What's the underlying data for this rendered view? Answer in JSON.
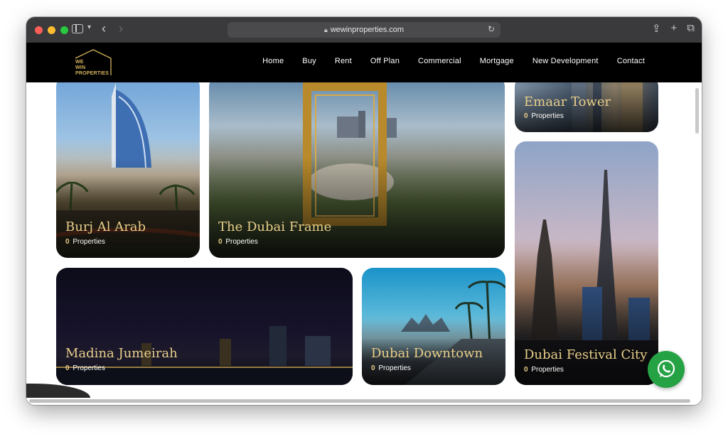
{
  "browser": {
    "url": "wewinproperties.com"
  },
  "site": {
    "logo_text": [
      "WE",
      "WIN",
      "PROPERTIES"
    ],
    "nav": [
      "Home",
      "Buy",
      "Rent",
      "Off Plan",
      "Commercial",
      "Mortgage",
      "New Development",
      "Contact"
    ]
  },
  "cards": {
    "burj": {
      "title": "Burj Al Arab",
      "count": "0",
      "label": "Properties"
    },
    "frame": {
      "title": "The Dubai Frame",
      "count": "0",
      "label": "Properties"
    },
    "emaar": {
      "title": "Emaar Tower",
      "count": "0",
      "label": "Properties"
    },
    "festival": {
      "title": "Dubai Festival City",
      "count": "0",
      "label": "Properties"
    },
    "madina": {
      "title": "Madina Jumeirah",
      "count": "0",
      "label": "Properties"
    },
    "downtown": {
      "title": "Dubai Downtown",
      "count": "0",
      "label": "Properties"
    }
  },
  "colors": {
    "accent_gold": "#e9cf8a",
    "header_bg": "#000000",
    "whatsapp_green": "#25a244"
  },
  "icons": [
    "sidebar-icon",
    "back-icon",
    "forward-icon",
    "lock-icon",
    "reload-icon",
    "share-icon",
    "new-tab-icon",
    "tabs-overview-icon",
    "whatsapp-icon"
  ]
}
